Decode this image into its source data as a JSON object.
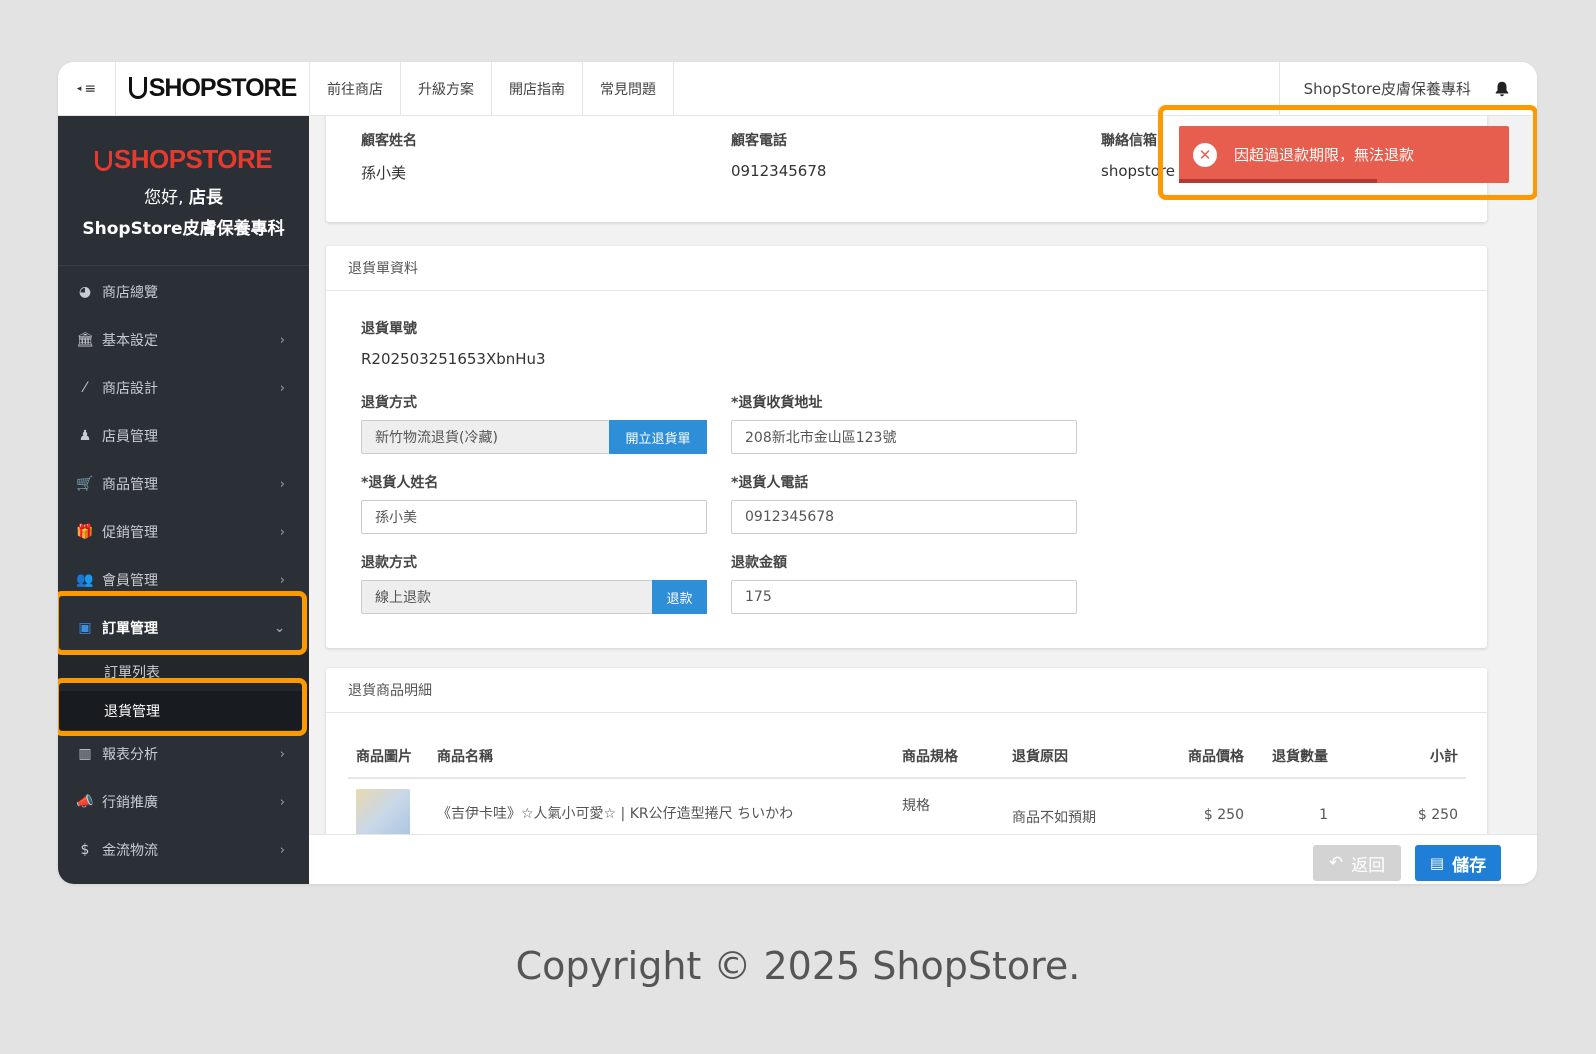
{
  "topbar": {
    "toggle_label": "≡",
    "logo_text": "SHOPSTORE",
    "nav": [
      "前往商店",
      "升級方案",
      "開店指南",
      "常見問題"
    ],
    "shop_name": "ShopStore皮膚保養專科"
  },
  "sidebar": {
    "brand_text": "SHOPSTORE",
    "greeting_prefix": "您好, ",
    "greeting_role": "店長",
    "shop_name": "ShopStore皮膚保養專科",
    "items": [
      {
        "label": "商店總覽",
        "icon": "dashboard-icon"
      },
      {
        "label": "基本設定",
        "icon": "bank-icon"
      },
      {
        "label": "商店設計",
        "icon": "magic-wand-icon"
      },
      {
        "label": "店員管理",
        "icon": "staff-icon"
      },
      {
        "label": "商品管理",
        "icon": "cart-icon"
      },
      {
        "label": "促銷管理",
        "icon": "gift-icon"
      },
      {
        "label": "會員管理",
        "icon": "users-icon"
      },
      {
        "label": "訂單管理",
        "icon": "orders-icon"
      },
      {
        "label": "訂單列表"
      },
      {
        "label": "退貨管理"
      },
      {
        "label": "報表分析",
        "icon": "bar-chart-icon"
      },
      {
        "label": "行銷推廣",
        "icon": "megaphone-icon"
      },
      {
        "label": "金流物流",
        "icon": "dollar-icon"
      }
    ],
    "colors": {
      "bg": "#2b3036",
      "highlight": "#ff9900"
    }
  },
  "customer": {
    "name_label": "顧客姓名",
    "name": "孫小美",
    "phone_label": "顧客電話",
    "phone": "0912345678",
    "email_label": "聯絡信箱",
    "email": "shopstore"
  },
  "return_info": {
    "title": "退貨單資料",
    "number_label": "退貨單號",
    "number": "R202503251653XbnHu3",
    "method_label": "退貨方式",
    "method": "新竹物流退貨(冷藏)",
    "method_btn": "開立退貨單",
    "address_label": "*退貨收貨地址",
    "address": "208新北市金山區123號",
    "returner_name_label": "*退貨人姓名",
    "returner_name": "孫小美",
    "returner_phone_label": "*退貨人電話",
    "returner_phone": "0912345678",
    "refund_method_label": "退款方式",
    "refund_method": "線上退款",
    "refund_btn": "退款",
    "refund_amount_label": "退款金額",
    "refund_amount": "175"
  },
  "items_table": {
    "title": "退貨商品明細",
    "headers": [
      "商品圖片",
      "商品名稱",
      "商品規格",
      "退貨原因",
      "商品價格",
      "退貨數量",
      "小計"
    ],
    "rows": [
      {
        "name": "《吉伊卡哇》☆人氣小可愛☆ | KR公仔造型捲尺 ちいかわ",
        "spec": "規格",
        "reason": "商品不如預期",
        "price": "$ 250",
        "qty": "1",
        "subtotal": "$ 250"
      }
    ]
  },
  "actions": {
    "back": "返回",
    "save": "儲存"
  },
  "toast": {
    "message": "因超過退款期限，無法退款",
    "progress": 0.6,
    "color": "#e85e4e"
  },
  "copyright": "Copyright © 2025 ShopStore."
}
